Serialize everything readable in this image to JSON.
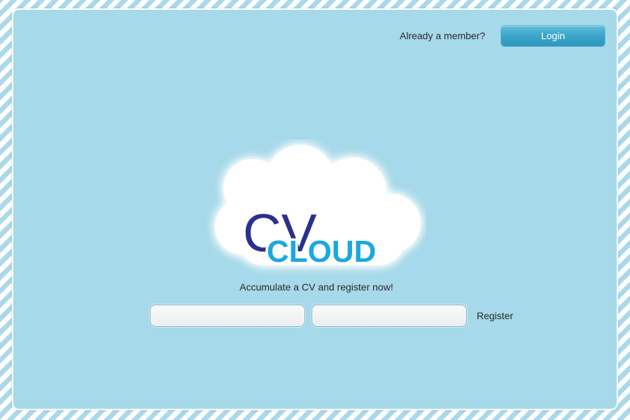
{
  "header": {
    "member_text": "Already a member?",
    "login_label": "Login"
  },
  "logo": {
    "line1": "CV",
    "line2": "CLOUD",
    "colors": {
      "cv": "#2b2f8f",
      "cloud_text": "#1ba8e0",
      "cloud_shape": "#ffffff"
    }
  },
  "main": {
    "tagline": "Accumulate a CV and register now!",
    "field1": {
      "value": "",
      "placeholder": ""
    },
    "field2": {
      "value": "",
      "placeholder": ""
    },
    "register_label": "Register"
  },
  "colors": {
    "panel_bg": "#a6d9e9",
    "stripe": "#a9d9ea",
    "button": "#3aa4c9"
  }
}
